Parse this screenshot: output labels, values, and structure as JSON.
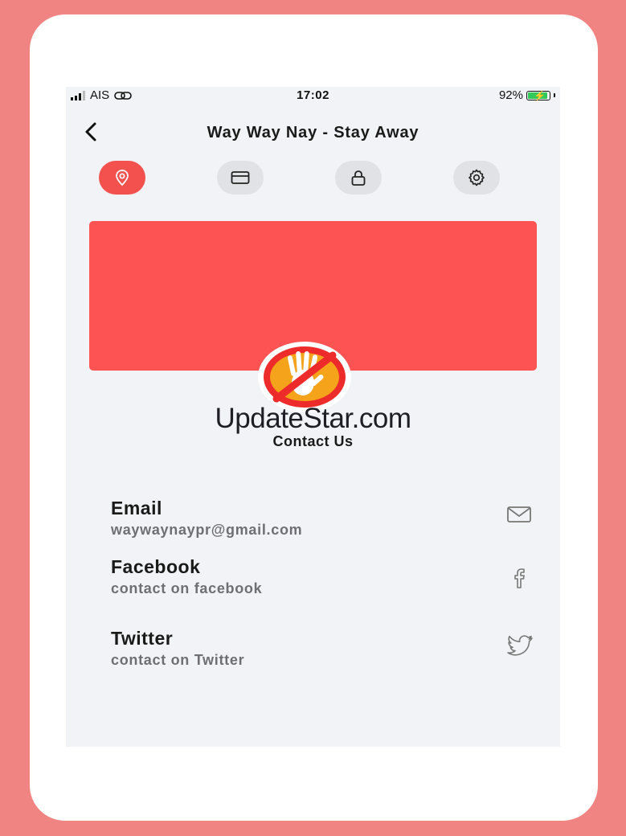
{
  "status_bar": {
    "carrier": "AIS",
    "time": "17:02",
    "battery": "92%",
    "battery_level": 0.92
  },
  "header": {
    "title": "Way Way Nay - Stay Away"
  },
  "tabs": [
    {
      "icon": "location-pin-icon",
      "active": true
    },
    {
      "icon": "credit-card-icon",
      "active": false
    },
    {
      "icon": "lock-icon",
      "active": false
    },
    {
      "icon": "gear-icon",
      "active": false
    }
  ],
  "watermark": "UpdateStar.com",
  "section": {
    "title": "Contact Us"
  },
  "contacts": [
    {
      "label": "Email",
      "detail": "waywaynaypr@gmail.com",
      "icon": "mail-icon"
    },
    {
      "label": "Facebook",
      "detail": "contact on facebook",
      "icon": "facebook-icon"
    },
    {
      "label": "Twitter",
      "detail": "contact on Twitter",
      "icon": "twitter-icon"
    }
  ],
  "colors": {
    "accent": "#f2514e",
    "banner": "#fd5353",
    "background": "#f08482",
    "screen": "#f2f3f7"
  }
}
